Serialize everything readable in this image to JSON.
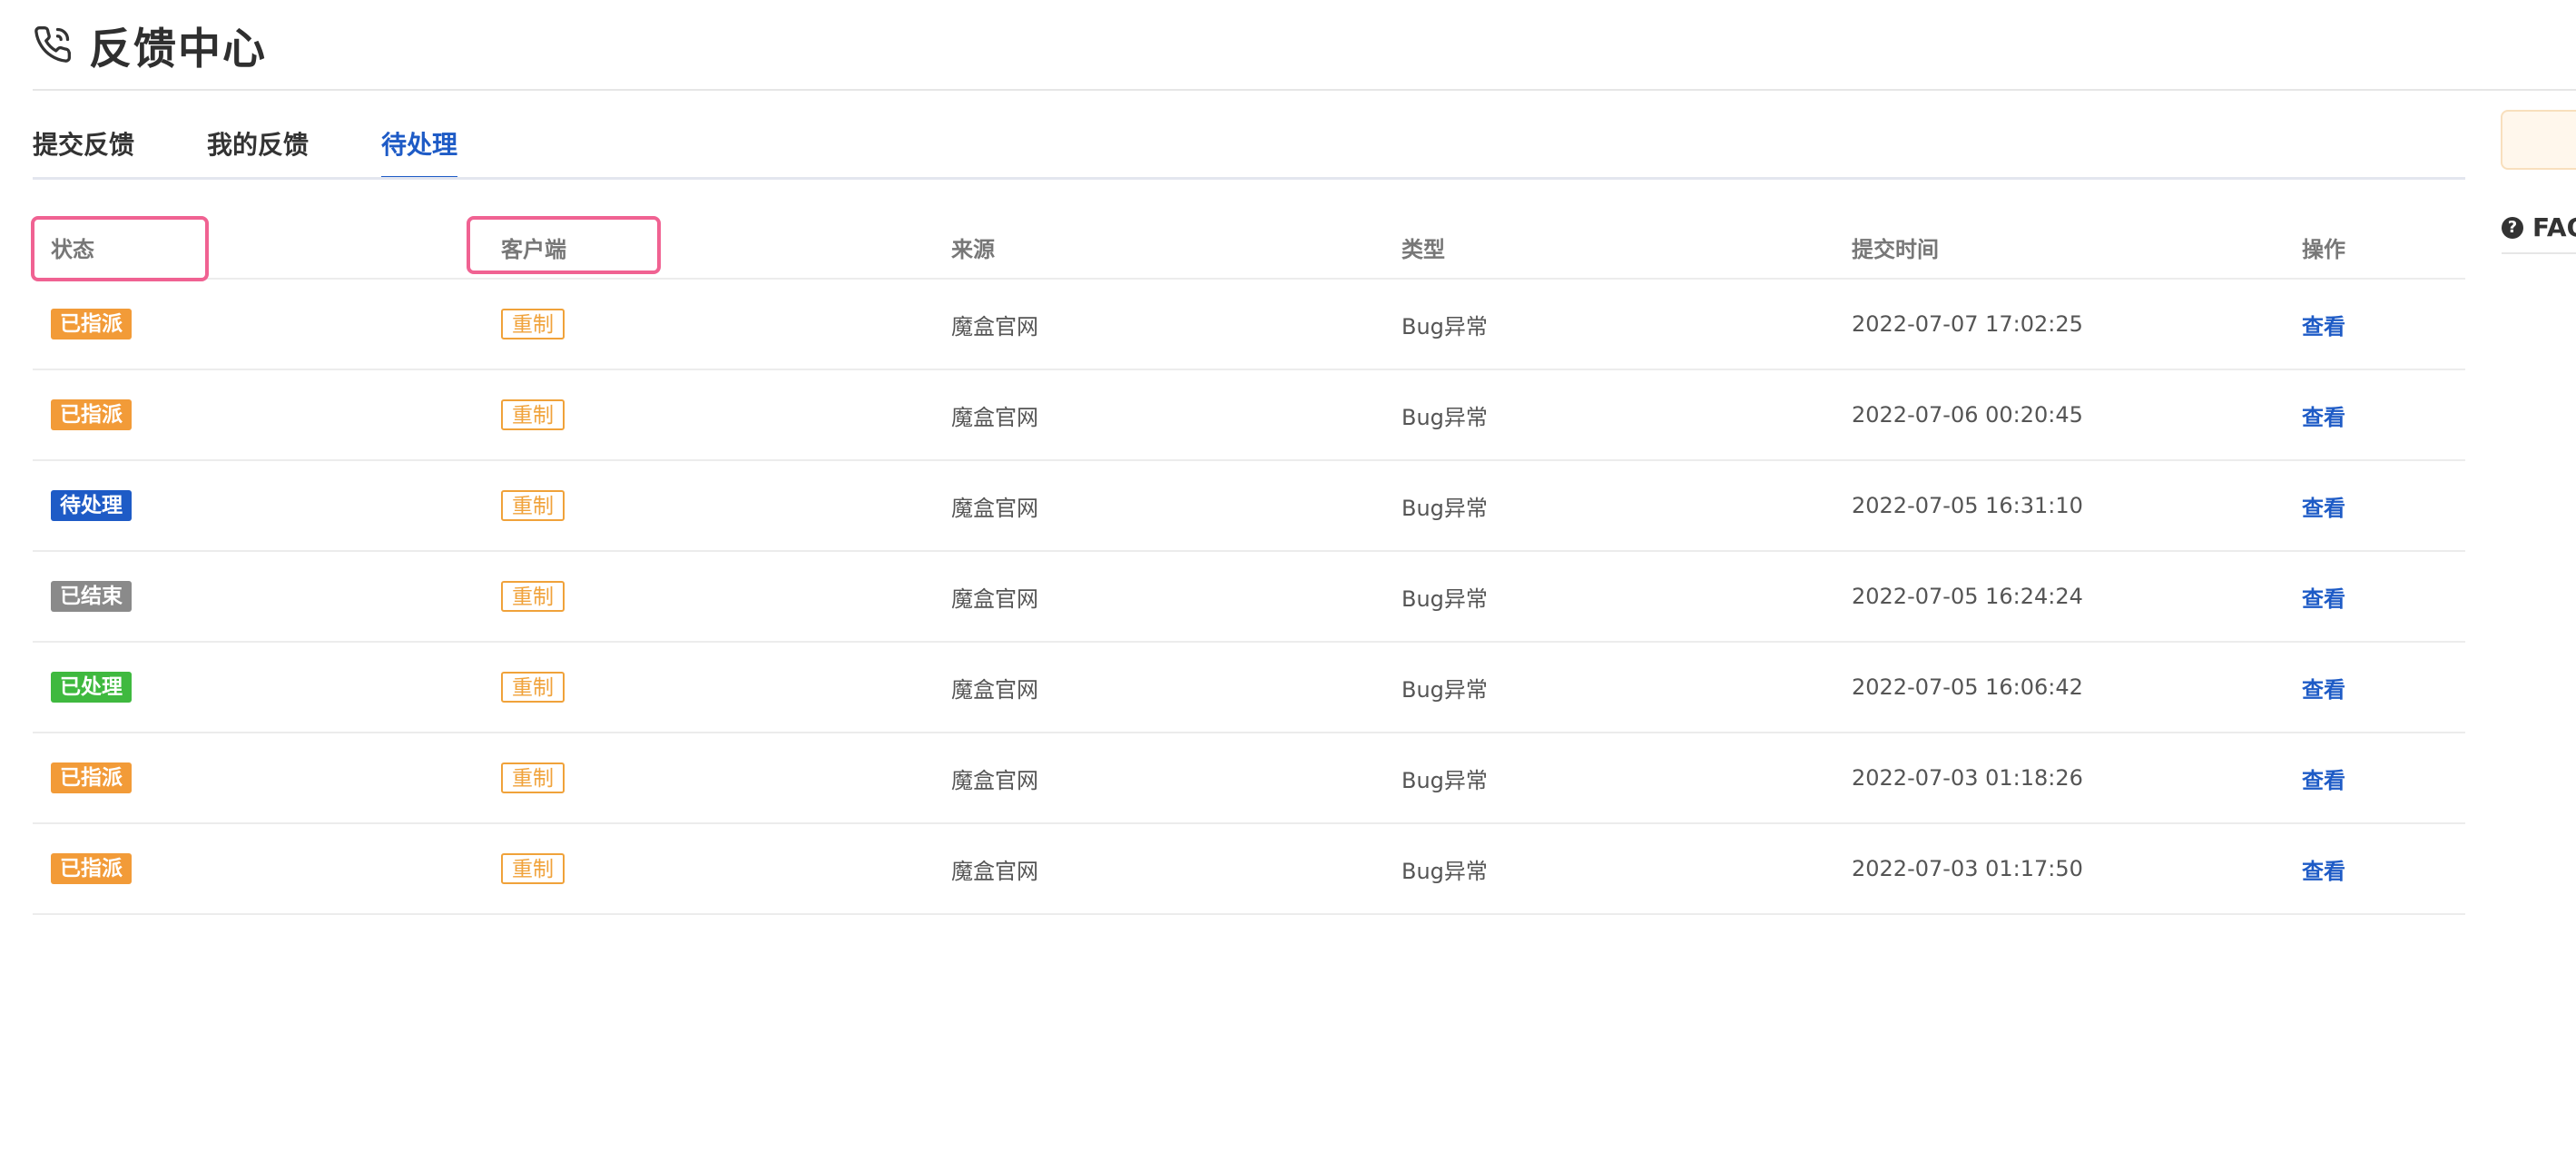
{
  "header": {
    "title": "反馈中心"
  },
  "tabs": [
    {
      "label": "提交反馈",
      "active": false
    },
    {
      "label": "我的反馈",
      "active": false
    },
    {
      "label": "待处理",
      "active": true
    }
  ],
  "sidebar": {
    "faq_label": "FAQ"
  },
  "table": {
    "columns": [
      "状态",
      "客户端",
      "来源",
      "类型",
      "提交时间",
      "操作"
    ],
    "rows": [
      {
        "status": "已指派",
        "status_color": "#f29b38",
        "client": "重制",
        "source": "魔盒官网",
        "type": "Bug异常",
        "time": "2022-07-07 17:02:25",
        "action": "查看"
      },
      {
        "status": "已指派",
        "status_color": "#f29b38",
        "client": "重制",
        "source": "魔盒官网",
        "type": "Bug异常",
        "time": "2022-07-06 00:20:45",
        "action": "查看"
      },
      {
        "status": "待处理",
        "status_color": "#1e5bc6",
        "client": "重制",
        "source": "魔盒官网",
        "type": "Bug异常",
        "time": "2022-07-05 16:31:10",
        "action": "查看"
      },
      {
        "status": "已结束",
        "status_color": "#8a8a8a",
        "client": "重制",
        "source": "魔盒官网",
        "type": "Bug异常",
        "time": "2022-07-05 16:24:24",
        "action": "查看"
      },
      {
        "status": "已处理",
        "status_color": "#3fb93f",
        "client": "重制",
        "source": "魔盒官网",
        "type": "Bug异常",
        "time": "2022-07-05 16:06:42",
        "action": "查看"
      },
      {
        "status": "已指派",
        "status_color": "#f29b38",
        "client": "重制",
        "source": "魔盒官网",
        "type": "Bug异常",
        "time": "2022-07-03 01:18:26",
        "action": "查看"
      },
      {
        "status": "已指派",
        "status_color": "#f29b38",
        "client": "重制",
        "source": "魔盒官网",
        "type": "Bug异常",
        "time": "2022-07-03 01:17:50",
        "action": "查看"
      }
    ]
  },
  "colors": {
    "accent": "#1e5bc6",
    "highlight": "#f06292",
    "client_badge": "#f0a23a"
  }
}
